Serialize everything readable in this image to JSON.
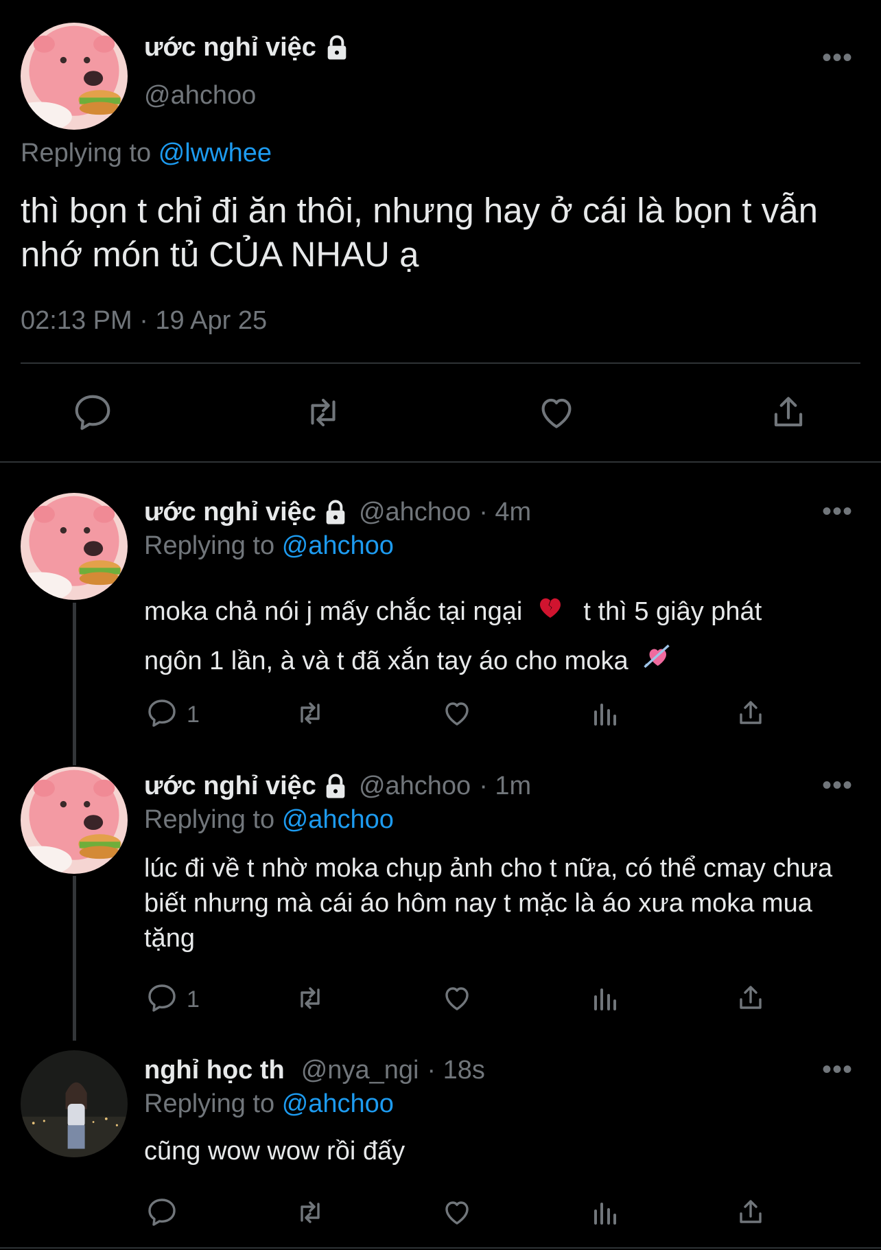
{
  "main_tweet": {
    "display_name": "ước nghỉ việc",
    "handle": "@ahchoo",
    "replying_prefix": "Replying to",
    "replying_to": "@lwwhee",
    "text": "thì bọn t chỉ đi ăn thôi, nhưng hay ở cái là bọn t vẫn nhớ món tủ CỦA NHAU ạ",
    "timestamp": "02:13 PM · 19 Apr 25",
    "more": "•••",
    "avatar": "pink-bear-burger-avatar",
    "icons": [
      "reply-icon",
      "retweet-icon",
      "like-icon",
      "share-icon"
    ]
  },
  "replies": [
    {
      "display_name": "ước nghỉ việc",
      "handle": "@ahchoo",
      "time": "· 4m",
      "replying_prefix": "Replying to",
      "replying_to": "@ahchoo",
      "text_line1": "moka chả nói j mấy chắc tại ngại",
      "text_line1b": "t thì 5 giây phát",
      "text_line2": "ngôn 1 lần, à và t đã xắn tay áo cho moka",
      "emoji1": "broken-heart",
      "emoji2": "heart-with-arrow",
      "reply_count": "1",
      "more": "•••"
    },
    {
      "display_name": "ước nghỉ việc",
      "handle": "@ahchoo",
      "time": "· 1m",
      "replying_prefix": "Replying to",
      "replying_to": "@ahchoo",
      "text": "lúc đi về t nhờ moka chụp ảnh cho t nữa, có thể cmay chưa biết nhưng mà cái áo hôm nay t mặc là áo xưa moka mua tặng",
      "reply_count": "1",
      "more": "•••"
    },
    {
      "display_name": "nghỉ học th",
      "handle": "@nya_ngi",
      "time": "· 18s",
      "replying_prefix": "Replying to",
      "replying_to": "@ahchoo",
      "text": "cũng wow wow rồi đấy",
      "reply_count": "",
      "more": "•••"
    }
  ],
  "colors": {
    "background": "#000000",
    "text": "#e7e9ea",
    "muted": "#71767b",
    "link": "#1d9bf0",
    "divider": "#2f3336"
  }
}
